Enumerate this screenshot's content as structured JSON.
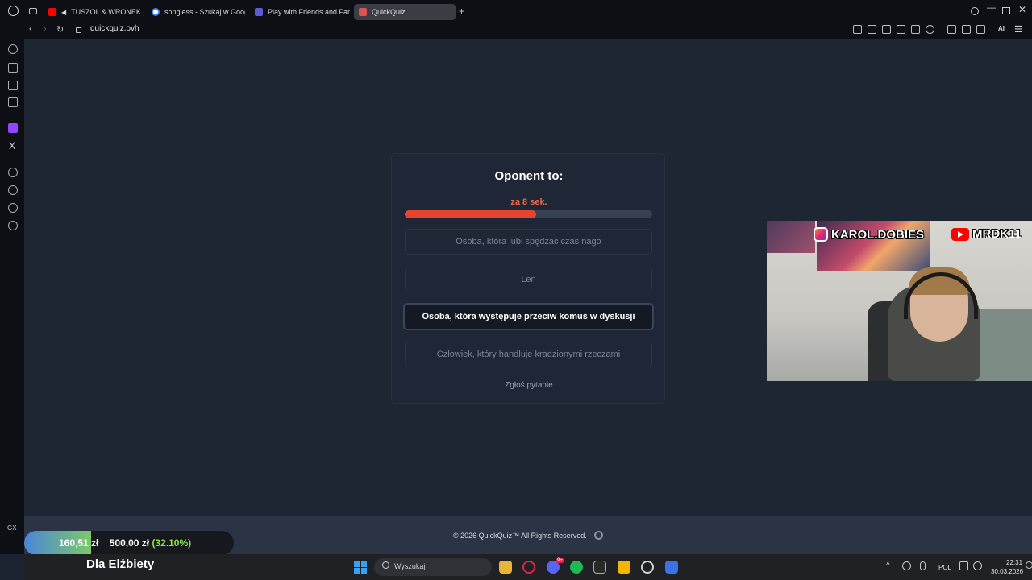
{
  "browser": {
    "tabs": [
      {
        "label": "TUSZOL & WRONEK -",
        "favicon_color": "#ff0000"
      },
      {
        "label": "songless - Szukaj w Goog",
        "favicon_color": "#4285f4"
      },
      {
        "label": "Play with Friends and Fam",
        "favicon_color": "#5b5bd6"
      },
      {
        "label": "QuickQuiz",
        "favicon_color": "#d9534f"
      }
    ],
    "new_tab_label": "+",
    "url": "quickquiz.ovh",
    "ai_label": "AI"
  },
  "sidebar": {
    "gx_label": "GX",
    "more_label": "···",
    "x_label": "X"
  },
  "quiz": {
    "title": "Oponent to:",
    "timer": "za 8 sek.",
    "progress_fraction": 0.53,
    "options": [
      {
        "label": "Osoba, która lubi spędzać czas nago",
        "selected": false
      },
      {
        "label": "Leń",
        "selected": false
      },
      {
        "label": "Osoba, która występuje przeciw komuś w dyskusji",
        "selected": true
      },
      {
        "label": "Człowiek, który handluje kradzionymi rzeczami",
        "selected": false
      }
    ],
    "report_label": "Zgłoś pytanie"
  },
  "footer": {
    "text": "© 2026  QuickQuiz™ All Rights Reserved."
  },
  "stream": {
    "instagram_handle": "KAROL.DOBIES",
    "youtube_handle": "MRDK11",
    "donation": {
      "current": "160,51 zł",
      "goal": "500,00 zł",
      "percent": "(32.10%)",
      "fraction": 0.321,
      "title": "Dla Elżbiety"
    }
  },
  "taskbar": {
    "search_placeholder": "Wyszukaj",
    "language": "POL",
    "time": "22:31",
    "date": "30.03.2026",
    "discord_badge": "9+"
  },
  "colors": {
    "accent": "#e5452f",
    "timer": "#f06a48",
    "page_bg": "#1e2634"
  }
}
